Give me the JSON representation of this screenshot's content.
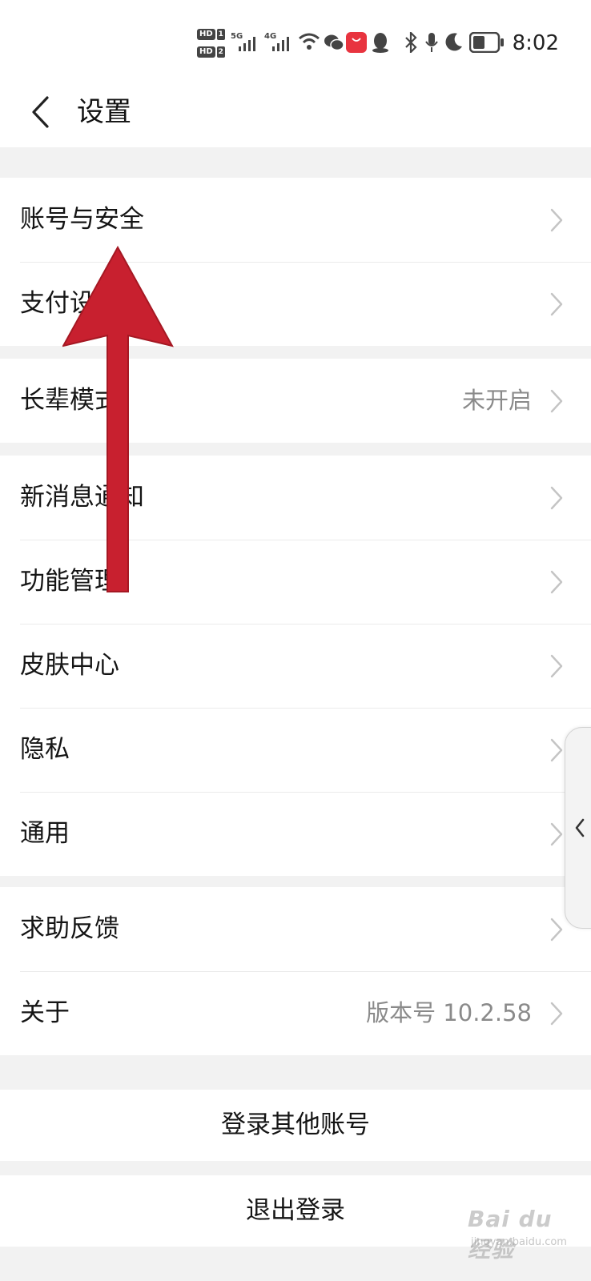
{
  "status_bar": {
    "hd_label": "HD",
    "sim1": "1",
    "sim2": "2",
    "net1": "5G",
    "net2": "4G",
    "time": "8:02",
    "icons": [
      "signal-icon",
      "wifi-icon",
      "wechat-icon",
      "huawei-store-icon",
      "qq-icon",
      "bluetooth-icon",
      "microphone-icon",
      "moon-icon",
      "battery-icon"
    ],
    "battery_level": 0.4
  },
  "header": {
    "back_icon": "chevron-left-icon",
    "title": "设置"
  },
  "groups": [
    [
      {
        "label": "账号与安全",
        "value": ""
      },
      {
        "label": "支付设置",
        "value": ""
      }
    ],
    [
      {
        "label": "长辈模式",
        "value": "未开启"
      }
    ],
    [
      {
        "label": "新消息通知",
        "value": ""
      },
      {
        "label": "功能管理",
        "value": ""
      },
      {
        "label": "皮肤中心",
        "value": ""
      },
      {
        "label": "隐私",
        "value": ""
      },
      {
        "label": "通用",
        "value": ""
      }
    ],
    [
      {
        "label": "求助反馈",
        "value": ""
      },
      {
        "label": "关于",
        "value": "版本号 10.2.58"
      }
    ]
  ],
  "actions": {
    "switch_account": "登录其他账号",
    "logout": "退出登录"
  },
  "overlay": {
    "arrow_color": "#c8202f",
    "side_tab_icon": "chevron-left-icon"
  },
  "watermark": {
    "main": "Bai du 经验",
    "sub": "jingyan.baidu.com"
  },
  "colors": {
    "background": "#f2f2f2",
    "card": "#ffffff",
    "secondary_text": "#8a8a8a"
  }
}
